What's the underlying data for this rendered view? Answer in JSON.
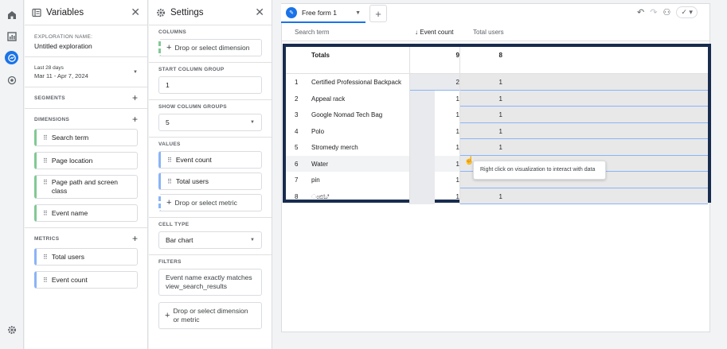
{
  "variables_panel": {
    "title": "Variables",
    "exploration_name_label": "EXPLORATION NAME:",
    "exploration_name": "Untitled exploration",
    "date_range_label": "Last 28 days",
    "date_range_value": "Mar 11 - Apr 7, 2024",
    "segments_label": "SEGMENTS",
    "dimensions_label": "DIMENSIONS",
    "dimensions": [
      "Search term",
      "Page location",
      "Page path and screen class",
      "Event name"
    ],
    "metrics_label": "METRICS",
    "metrics": [
      "Total users",
      "Event count"
    ]
  },
  "settings_panel": {
    "title": "Settings",
    "columns_label": "COLUMNS",
    "columns_drop": "Drop or select dimension",
    "start_column_group_label": "START COLUMN GROUP",
    "start_column_group": "1",
    "show_column_groups_label": "SHOW COLUMN GROUPS",
    "show_column_groups": "5",
    "values_label": "VALUES",
    "values": [
      "Event count",
      "Total users"
    ],
    "values_drop": "Drop or select metric",
    "cell_type_label": "CELL TYPE",
    "cell_type": "Bar chart",
    "filters_label": "FILTERS",
    "filter": "Event name exactly matches view_search_results",
    "filters_drop": "Drop or select dimension or metric"
  },
  "canvas": {
    "tab_title": "Free form 1",
    "headers": {
      "search_term": "Search term",
      "event_count": "Event count",
      "total_users": "Total users",
      "sort_arrow": "↓"
    },
    "totals": {
      "label": "Totals",
      "event_count": "9",
      "total_users": "8"
    },
    "rows": [
      {
        "n": "1",
        "term": "Certified Professional Backpack",
        "ev": "2",
        "us": "1",
        "ev_frac": 1.0
      },
      {
        "n": "2",
        "term": "Appeal rack",
        "ev": "1",
        "us": "1",
        "ev_frac": 0.5
      },
      {
        "n": "3",
        "term": "Google Nomad Tech Bag",
        "ev": "1",
        "us": "1",
        "ev_frac": 0.5
      },
      {
        "n": "4",
        "term": "Polo",
        "ev": "1",
        "us": "1",
        "ev_frac": 0.5
      },
      {
        "n": "5",
        "term": "Stromedy merch",
        "ev": "1",
        "us": "1",
        "ev_frac": 0.5
      },
      {
        "n": "6",
        "term": "Water",
        "ev": "1",
        "us": "",
        "ev_frac": 0.5
      },
      {
        "n": "7",
        "term": "pin",
        "ev": "1",
        "us": "",
        "ev_frac": 0.5
      },
      {
        "n": "8",
        "term": "ಂಬಿಓಿ",
        "ev": "1",
        "us": "1",
        "ev_frac": 0.5
      }
    ],
    "tooltip": "Right click on visualization to interact with data"
  },
  "colors": {
    "accent": "#1a73e8",
    "frame": "#182c4e",
    "dimension": "#81c995",
    "metric": "#8ab4f8"
  }
}
